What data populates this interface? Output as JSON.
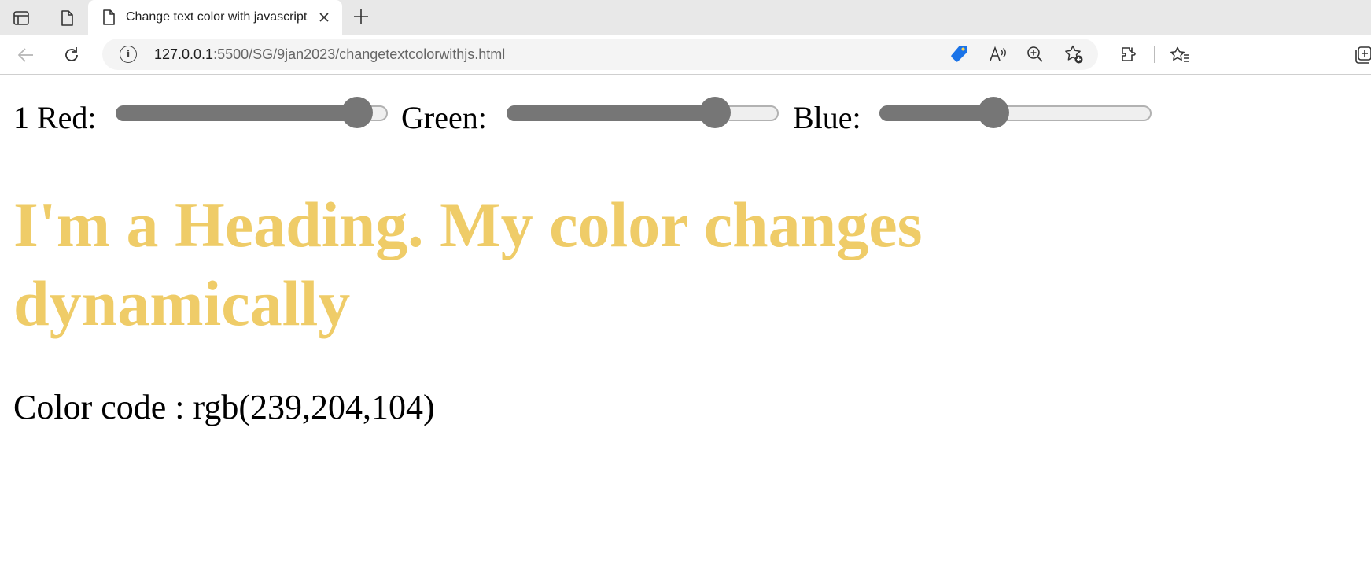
{
  "browser": {
    "tab": {
      "title": "Change text color with javascript"
    },
    "address": {
      "host": "127.0.0.1",
      "path": ":5500/SG/9jan2023/changetextcolorwithjs.html"
    },
    "icons": {
      "tab_actions": "tab-actions-icon",
      "workspaces": "page-icon",
      "tab_page": "page-icon",
      "close": "close-icon",
      "new_tab": "plus-icon",
      "back": "back-arrow-icon",
      "refresh": "refresh-icon",
      "site_info": "info-icon",
      "coupon": "tag-icon",
      "read_aloud": "read-aloud-icon",
      "zoom": "zoom-icon",
      "add_favorite": "add-favorite-icon",
      "extensions": "extensions-icon",
      "favorites": "favorites-icon",
      "collections": "collections-icon"
    },
    "colors": {
      "coupon_tag": "#1a73e8"
    }
  },
  "page": {
    "controls": {
      "red": {
        "label": "1 Red:",
        "value": 239,
        "max": 255
      },
      "green": {
        "label": "Green:",
        "value": 204,
        "max": 255
      },
      "blue": {
        "label": "Blue:",
        "value": 104,
        "max": 255
      }
    },
    "heading": {
      "text": "I'm a Heading. My color changes dynamically",
      "color": "rgb(239,204,104)"
    },
    "color_code": {
      "text": "Color code : rgb(239,204,104)"
    }
  }
}
